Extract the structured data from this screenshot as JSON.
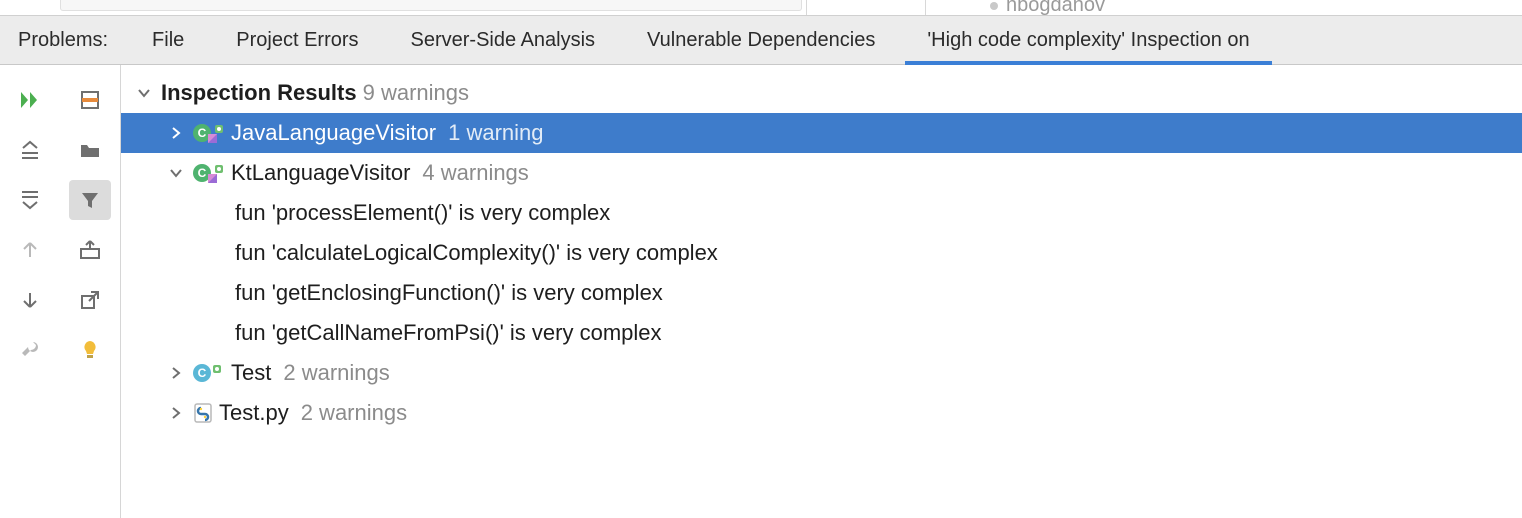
{
  "top_strip": {
    "user_fragment": "nbogdanov"
  },
  "tabs": {
    "prefix": "Problems:",
    "items": [
      "File",
      "Project Errors",
      "Server-Side Analysis",
      "Vulnerable Dependencies",
      "'High code complexity' Inspection on"
    ],
    "active_index": 4
  },
  "tree": {
    "root": {
      "label": "Inspection Results",
      "suffix": "9 warnings"
    },
    "nodes": [
      {
        "icon": "class-kotlin",
        "name": "JavaLanguageVisitor",
        "suffix": "1 warning",
        "expanded": false,
        "selected": true,
        "children": []
      },
      {
        "icon": "class-kotlin",
        "name": "KtLanguageVisitor",
        "suffix": "4 warnings",
        "expanded": true,
        "selected": false,
        "children": [
          "fun 'processElement()' is very complex",
          "fun 'calculateLogicalComplexity()' is very complex",
          "fun 'getEnclosingFunction()' is very complex",
          "fun 'getCallNameFromPsi()' is very complex"
        ]
      },
      {
        "icon": "class-c",
        "name": "Test",
        "suffix": "2 warnings",
        "expanded": false,
        "selected": false,
        "children": []
      },
      {
        "icon": "python",
        "name": "Test.py",
        "suffix": "2 warnings",
        "expanded": false,
        "selected": false,
        "children": []
      }
    ]
  },
  "toolbar_icons": [
    "rerun",
    "autoscroll",
    "expand-all",
    "directory",
    "collapse-all",
    "filter",
    "prev",
    "export",
    "next",
    "open-external",
    "settings",
    "intention-bulb"
  ]
}
